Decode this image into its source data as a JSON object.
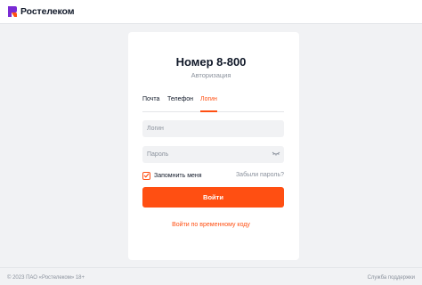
{
  "header": {
    "brand": "Ростелеком"
  },
  "login": {
    "title": "Номер 8-800",
    "subtitle": "Авторизация",
    "tabs": [
      {
        "label": "Почта",
        "active": false
      },
      {
        "label": "Телефон",
        "active": false
      },
      {
        "label": "Логин",
        "active": true
      }
    ],
    "login_field": {
      "placeholder": "Логин",
      "value": ""
    },
    "password_field": {
      "placeholder": "Пароль",
      "value": ""
    },
    "remember_label": "Запомнить меня",
    "remember_checked": true,
    "forgot_link": "Забыли пароль?",
    "submit_label": "Войти",
    "temp_code_link": "Войти по временному коду"
  },
  "footer": {
    "copyright": "© 2023 ПАО «Ростелеком» 18+",
    "support_link": "Служба поддержки"
  },
  "colors": {
    "accent": "#ff4f12",
    "logo_purple": "#7a2bd4",
    "background": "#f1f2f4",
    "text": "#101828",
    "muted": "#8a919c"
  },
  "icons": [
    "rostelecom-logo-icon",
    "eye-closed-icon",
    "checkmark-icon"
  ]
}
